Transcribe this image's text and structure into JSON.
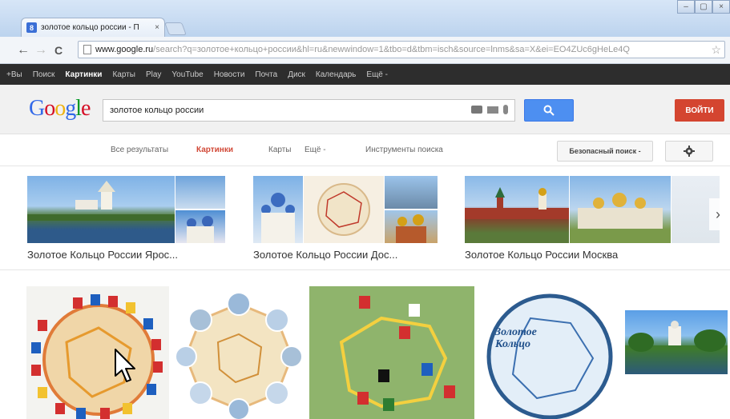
{
  "browser": {
    "tab_title": "золотое кольцо россии - П",
    "tab_favicon": "8",
    "tab_close": "×",
    "url_host": "www.google.ru",
    "url_path": "/search?q=золотое+кольцо+россии&hl=ru&newwindow=1&tbo=d&tbm=isch&source=lnms&sa=X&ei=EO4ZUc6gHeLe4Q",
    "back": "←",
    "forward": "→",
    "reload": "C",
    "star": "☆",
    "window_buttons": [
      "–",
      "▢",
      "×"
    ]
  },
  "gbar": [
    "+Вы",
    "Поиск",
    "Картинки",
    "Карты",
    "Play",
    "YouTube",
    "Новости",
    "Почта",
    "Диск",
    "Календарь",
    "Ещё -"
  ],
  "gbar_active_index": 2,
  "header": {
    "logo": "Google",
    "query": "золотое кольцо россии",
    "search_button_icon": "magnifier-icon",
    "signin_label": "ВОЙТИ"
  },
  "search_tabs": [
    "Все результаты",
    "Картинки",
    "Карты",
    "Ещё -",
    "Инструменты поиска"
  ],
  "search_tabs_active_index": 1,
  "safe_search": "Безопасный поиск -",
  "settings_icon": "gear-icon",
  "related": [
    {
      "caption": "Золотое Кольцо России Ярос..."
    },
    {
      "caption": "Золотое Кольцо России Дос..."
    },
    {
      "caption": "Золотое Кольцо России Москва"
    }
  ],
  "result_map_title": [
    "Золотое",
    "Кольцо"
  ],
  "colors": {
    "google_blue": "#4d8ff1",
    "signin_red": "#d44530",
    "active_tab_red": "#d14836",
    "gbar_bg": "#2d2d2d"
  }
}
